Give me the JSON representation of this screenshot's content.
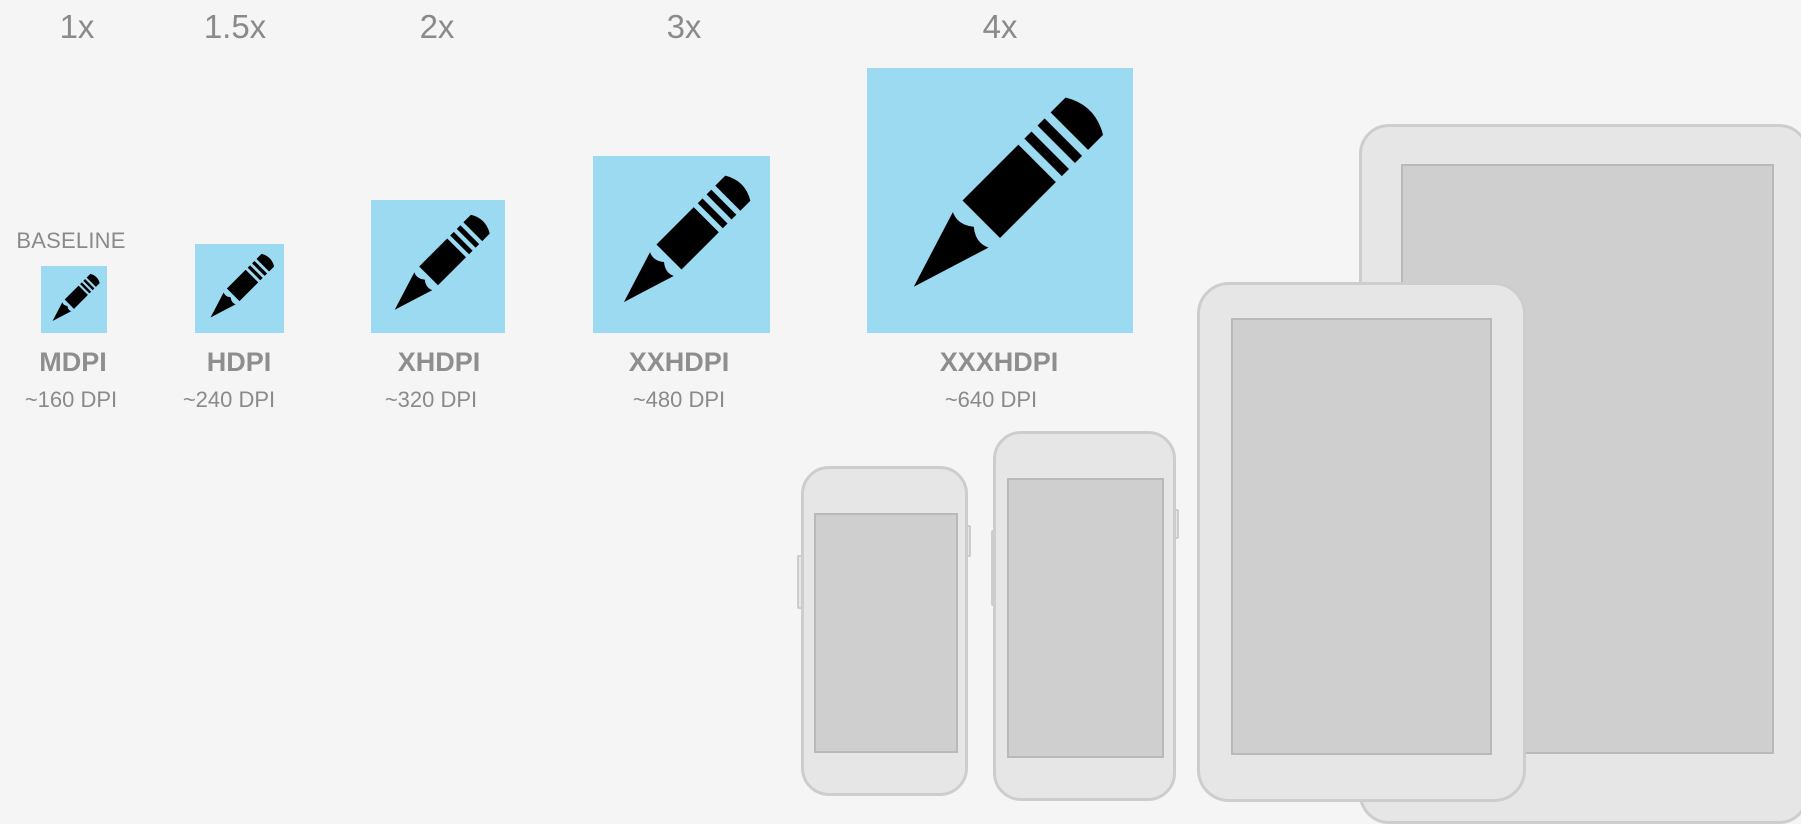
{
  "scales": [
    "1x",
    "1.5x",
    "2x",
    "3x",
    "4x"
  ],
  "baseline_label": "BASELINE",
  "densities": [
    {
      "name": "MDPI",
      "dpi": "~160 DPI"
    },
    {
      "name": "HDPI",
      "dpi": "~240 DPI"
    },
    {
      "name": "XHDPI",
      "dpi": "~320 DPI"
    },
    {
      "name": "XXHDPI",
      "dpi": "~480 DPI"
    },
    {
      "name": "XXXHDPI",
      "dpi": "~640 DPI"
    }
  ],
  "icon": "pencil-icon",
  "colors": {
    "background": "#f5f5f5",
    "icon_box": "#9cdaf2",
    "device_body": "#e6e6e6",
    "device_screen": "#cfcfcf"
  }
}
